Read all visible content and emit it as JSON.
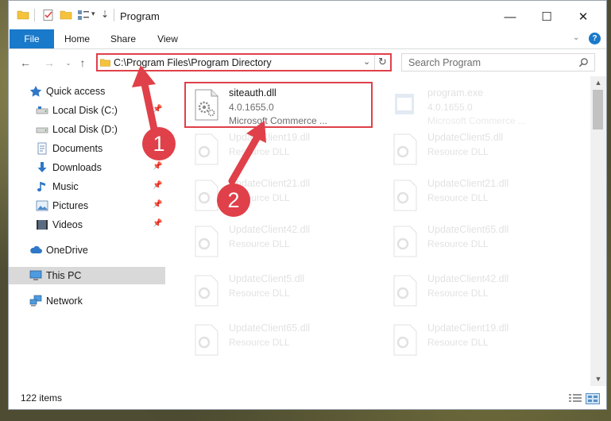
{
  "window": {
    "title": "Program",
    "quick_access_toolbar": [
      "folder-icon",
      "properties-check-icon",
      "new-folder-icon",
      "view-icon",
      "dropdown-icon"
    ],
    "controls": {
      "minimize": "—",
      "maximize": "☐",
      "close": "✕"
    }
  },
  "ribbon": {
    "tabs": [
      {
        "label": "File"
      },
      {
        "label": "Home"
      },
      {
        "label": "Share"
      },
      {
        "label": "View"
      }
    ]
  },
  "address": {
    "path": "C:\\Program Files\\Program Directory",
    "search_placeholder": "Search Program"
  },
  "nav": {
    "items": [
      {
        "label": "Quick access",
        "icon": "star-icon"
      },
      {
        "label": "Local Disk (C:)",
        "icon": "drive-icon",
        "pinned": true
      },
      {
        "label": "Local Disk (D:)",
        "icon": "drive-icon"
      },
      {
        "label": "Documents",
        "icon": "documents-icon",
        "pinned": true
      },
      {
        "label": "Downloads",
        "icon": "download-icon",
        "pinned": true
      },
      {
        "label": "Music",
        "icon": "music-icon",
        "pinned": true
      },
      {
        "label": "Pictures",
        "icon": "pictures-icon",
        "pinned": true
      },
      {
        "label": "Videos",
        "icon": "videos-icon",
        "pinned": true
      },
      {
        "label": "OneDrive",
        "icon": "cloud-icon"
      },
      {
        "label": "This PC",
        "icon": "computer-icon",
        "selected": true
      },
      {
        "label": "Network",
        "icon": "network-icon"
      }
    ]
  },
  "files": [
    {
      "name": "siteauth.dll",
      "line1": "4.0.1655.0",
      "line2": "Microsoft Commerce ...",
      "highlighted": true
    },
    {
      "name": "program.exe",
      "line1": "4.0.1655.0",
      "line2": "Microsoft Commerce ..."
    },
    {
      "name": "UpdateClient19.dll",
      "line1": "Resource DLL"
    },
    {
      "name": "UpdateClient5.dll",
      "line1": "Resource DLL"
    },
    {
      "name": "UpdateClient21.dll",
      "line1": "Resource DLL"
    },
    {
      "name": "UpdateClient21.dll",
      "line1": "Resource DLL"
    },
    {
      "name": "UpdateClient42.dll",
      "line1": "Resource DLL"
    },
    {
      "name": "UpdateClient65.dll",
      "line1": "Resource DLL"
    },
    {
      "name": "UpdateClient5.dll",
      "line1": "Resource DLL"
    },
    {
      "name": "UpdateClient42.dll",
      "line1": "Resource DLL"
    },
    {
      "name": "UpdateClient65.dll",
      "line1": "Resource DLL"
    },
    {
      "name": "UpdateClient19.dll",
      "line1": "Resource DLL"
    }
  ],
  "status": {
    "item_count": "122 items"
  },
  "callouts": [
    "1",
    "2"
  ],
  "colors": {
    "accent": "#1979ca",
    "highlight": "#e04049",
    "selected_nav": "#d9d9d9"
  }
}
